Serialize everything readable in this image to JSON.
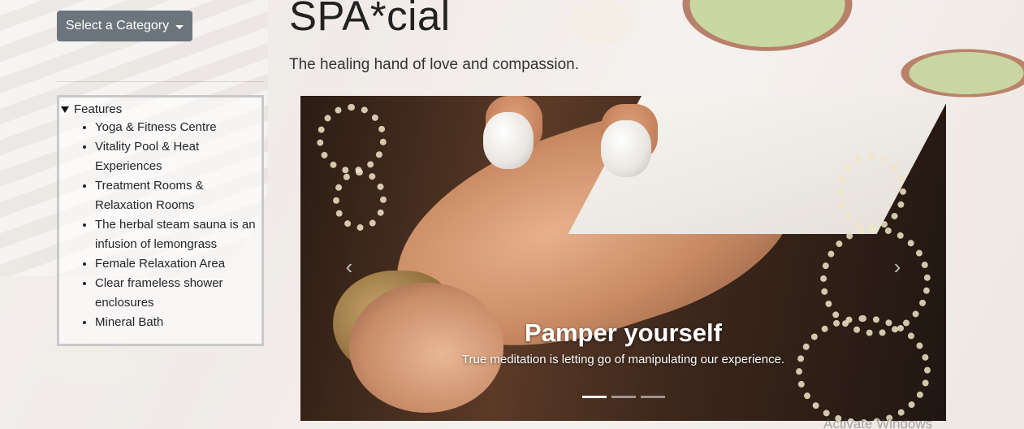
{
  "sidebar": {
    "category_button_label": "Select a Category",
    "features_summary": "Features",
    "features": [
      "Yoga & Fitness Centre",
      "Vitality Pool & Heat Experiences",
      "Treatment Rooms & Relaxation Rooms",
      "The herbal steam sauna is an infusion of lemongrass",
      "Female Relaxation Area",
      "Clear frameless shower enclosures",
      "Mineral Bath"
    ]
  },
  "header": {
    "title": "SPA*cial",
    "tagline": "The healing hand of love and compassion."
  },
  "carousel": {
    "caption_title": "Pamper yourself",
    "caption_text": "True meditation is letting go of manipulating our experience.",
    "slide_count": 3,
    "active_slide": 1,
    "prev_icon": "chevron-left-icon",
    "next_icon": "chevron-right-icon"
  },
  "watermark": "Activate Windows",
  "colors": {
    "button_bg": "#6c757d",
    "paisley": "#f1e6c8"
  }
}
